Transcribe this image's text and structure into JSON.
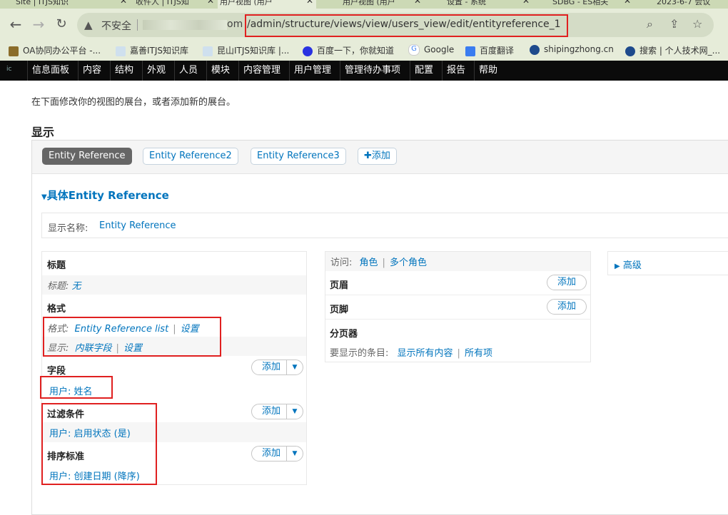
{
  "browser": {
    "tabs": [
      {
        "label": "Site | ITJS知识",
        "close": "✕"
      },
      {
        "label": "收件人 | ITJS知",
        "close": "✕"
      },
      {
        "label": "用户视图 (用户",
        "close": "✕"
      },
      {
        "label": "用户视图 (用户",
        "close": "✕"
      },
      {
        "label": "设置 - 系统",
        "close": "✕"
      },
      {
        "label": "SDBG - ES相关",
        "close": "✕"
      },
      {
        "label": "2023-6-7 会议",
        "close": ""
      }
    ],
    "address": {
      "security_label": "不安全",
      "host_suffix": "om",
      "path": "/admin/structure/views/view/users_view/edit/entityreference_1"
    },
    "bookmarks": [
      "OA协同办公平台 -...",
      "嘉善ITJS知识库",
      "昆山ITJS知识库 |...",
      "百度一下，你就知道",
      "Google",
      "百度翻译",
      "shipingzhong.cn",
      "搜索 | 个人技术网_..."
    ]
  },
  "admin_menu": {
    "logo": "ic",
    "items": [
      "信息面板",
      "内容",
      "结构",
      "外观",
      "人员",
      "模块",
      "内容管理",
      "用户管理",
      "管理待办事项",
      "配置",
      "报告",
      "帮助"
    ]
  },
  "page": {
    "intro": "在下面修改你的视图的展台，或者添加新的展台。",
    "display_heading": "显示",
    "display_tabs": [
      "Entity Reference",
      "Entity Reference2",
      "Entity Reference3"
    ],
    "add_display": "添加",
    "details_title": "具体Entity Reference",
    "display_name_label": "显示名称:",
    "display_name_value": "Entity Reference",
    "title_section": {
      "heading": "标题",
      "label": "标题:",
      "value": "无"
    },
    "format_section": {
      "heading": "格式",
      "format_label": "格式:",
      "format_value": "Entity Reference list",
      "format_settings": "设置",
      "show_label": "显示:",
      "show_value": "内联字段",
      "show_settings": "设置"
    },
    "fields_section": {
      "heading": "字段",
      "add": "添加",
      "item": "用户: 姓名"
    },
    "filter_section": {
      "heading": "过滤条件",
      "add": "添加",
      "item": "用户: 启用状态 (是)"
    },
    "sort_section": {
      "heading": "排序标准",
      "add": "添加",
      "item": "用户: 创建日期 (降序)"
    },
    "access": {
      "label": "访问:",
      "value1": "角色",
      "value2": "多个角色"
    },
    "header_section": {
      "heading": "页眉",
      "add": "添加"
    },
    "footer_section": {
      "heading": "页脚",
      "add": "添加"
    },
    "pager_section": {
      "heading": "分页器",
      "label": "要显示的条目:",
      "value1": "显示所有内容",
      "value2": "所有项"
    },
    "advanced": "高级"
  },
  "colors": {
    "accent": "#0074bd",
    "highlight": "#e02020",
    "admin_bar": "#0b0b0b"
  }
}
